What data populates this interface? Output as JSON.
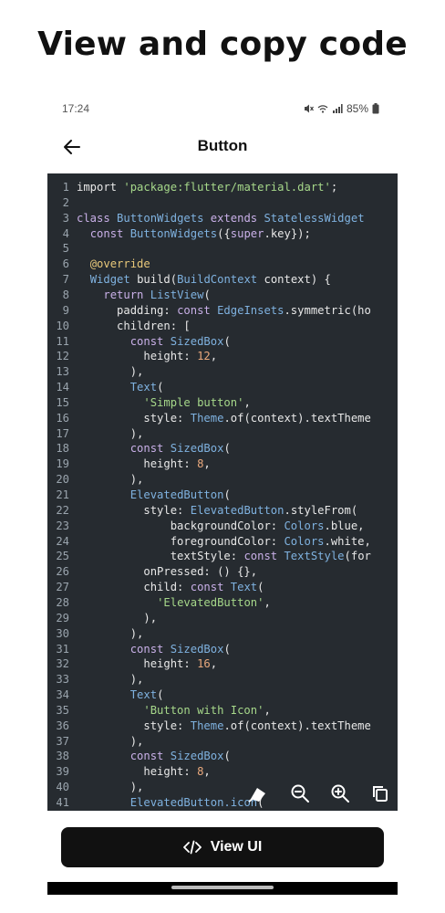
{
  "headline": "View and copy code",
  "status_bar": {
    "time": "17:24",
    "battery": "85%"
  },
  "app_bar": {
    "title": "Button"
  },
  "code_lines": [
    [
      [
        "tx",
        "import "
      ],
      [
        "st",
        "'package:flutter/material.dart'"
      ],
      [
        "tx",
        ";"
      ]
    ],
    [],
    [
      [
        "kw",
        "class "
      ],
      [
        "ty",
        "ButtonWidgets "
      ],
      [
        "kw",
        "extends "
      ],
      [
        "ty",
        "StatelessWidget"
      ]
    ],
    [
      [
        "tx",
        "  "
      ],
      [
        "kw",
        "const "
      ],
      [
        "ty",
        "ButtonWidgets"
      ],
      [
        "tx",
        "({"
      ],
      [
        "kw",
        "super"
      ],
      [
        "tx",
        ".key});"
      ]
    ],
    [],
    [
      [
        "tx",
        "  "
      ],
      [
        "an",
        "@override"
      ]
    ],
    [
      [
        "tx",
        "  "
      ],
      [
        "ty",
        "Widget "
      ],
      [
        "tx",
        "build("
      ],
      [
        "ty",
        "BuildContext "
      ],
      [
        "tx",
        "context) {"
      ]
    ],
    [
      [
        "tx",
        "    "
      ],
      [
        "kw",
        "return "
      ],
      [
        "ty",
        "ListView"
      ],
      [
        "tx",
        "("
      ]
    ],
    [
      [
        "tx",
        "      padding: "
      ],
      [
        "kw",
        "const "
      ],
      [
        "ty",
        "EdgeInsets"
      ],
      [
        "tx",
        ".symmetric(ho"
      ]
    ],
    [
      [
        "tx",
        "      children: ["
      ]
    ],
    [
      [
        "tx",
        "        "
      ],
      [
        "kw",
        "const "
      ],
      [
        "ty",
        "SizedBox"
      ],
      [
        "tx",
        "("
      ]
    ],
    [
      [
        "tx",
        "          height: "
      ],
      [
        "nu",
        "12"
      ],
      [
        "tx",
        ","
      ]
    ],
    [
      [
        "tx",
        "        ),"
      ]
    ],
    [
      [
        "tx",
        "        "
      ],
      [
        "ty",
        "Text"
      ],
      [
        "tx",
        "("
      ]
    ],
    [
      [
        "tx",
        "          "
      ],
      [
        "st",
        "'Simple button'"
      ],
      [
        "tx",
        ","
      ]
    ],
    [
      [
        "tx",
        "          style: "
      ],
      [
        "ty",
        "Theme"
      ],
      [
        "tx",
        ".of(context).textTheme"
      ]
    ],
    [
      [
        "tx",
        "        ),"
      ]
    ],
    [
      [
        "tx",
        "        "
      ],
      [
        "kw",
        "const "
      ],
      [
        "ty",
        "SizedBox"
      ],
      [
        "tx",
        "("
      ]
    ],
    [
      [
        "tx",
        "          height: "
      ],
      [
        "nu",
        "8"
      ],
      [
        "tx",
        ","
      ]
    ],
    [
      [
        "tx",
        "        ),"
      ]
    ],
    [
      [
        "tx",
        "        "
      ],
      [
        "ty",
        "ElevatedButton"
      ],
      [
        "tx",
        "("
      ]
    ],
    [
      [
        "tx",
        "          style: "
      ],
      [
        "ty",
        "ElevatedButton"
      ],
      [
        "tx",
        ".styleFrom("
      ]
    ],
    [
      [
        "tx",
        "              backgroundColor: "
      ],
      [
        "ty",
        "Colors"
      ],
      [
        "tx",
        ".blue,"
      ]
    ],
    [
      [
        "tx",
        "              foregroundColor: "
      ],
      [
        "ty",
        "Colors"
      ],
      [
        "tx",
        ".white,"
      ]
    ],
    [
      [
        "tx",
        "              textStyle: "
      ],
      [
        "kw",
        "const "
      ],
      [
        "ty",
        "TextStyle"
      ],
      [
        "tx",
        "(for"
      ]
    ],
    [
      [
        "tx",
        "          onPressed: () {},"
      ]
    ],
    [
      [
        "tx",
        "          child: "
      ],
      [
        "kw",
        "const "
      ],
      [
        "ty",
        "Text"
      ],
      [
        "tx",
        "("
      ]
    ],
    [
      [
        "tx",
        "            "
      ],
      [
        "st",
        "'ElevatedButton'"
      ],
      [
        "tx",
        ","
      ]
    ],
    [
      [
        "tx",
        "          ),"
      ]
    ],
    [
      [
        "tx",
        "        ),"
      ]
    ],
    [
      [
        "tx",
        "        "
      ],
      [
        "kw",
        "const "
      ],
      [
        "ty",
        "SizedBox"
      ],
      [
        "tx",
        "("
      ]
    ],
    [
      [
        "tx",
        "          height: "
      ],
      [
        "nu",
        "16"
      ],
      [
        "tx",
        ","
      ]
    ],
    [
      [
        "tx",
        "        ),"
      ]
    ],
    [
      [
        "tx",
        "        "
      ],
      [
        "ty",
        "Text"
      ],
      [
        "tx",
        "("
      ]
    ],
    [
      [
        "tx",
        "          "
      ],
      [
        "st",
        "'Button with Icon'"
      ],
      [
        "tx",
        ","
      ]
    ],
    [
      [
        "tx",
        "          style: "
      ],
      [
        "ty",
        "Theme"
      ],
      [
        "tx",
        ".of(context).textTheme"
      ]
    ],
    [
      [
        "tx",
        "        ),"
      ]
    ],
    [
      [
        "tx",
        "        "
      ],
      [
        "kw",
        "const "
      ],
      [
        "ty",
        "SizedBox"
      ],
      [
        "tx",
        "("
      ]
    ],
    [
      [
        "tx",
        "          height: "
      ],
      [
        "nu",
        "8"
      ],
      [
        "tx",
        ","
      ]
    ],
    [
      [
        "tx",
        "        ),"
      ]
    ],
    [
      [
        "tx",
        "        "
      ],
      [
        "ty",
        "ElevatedButton.icon"
      ],
      [
        "tx",
        "("
      ]
    ]
  ],
  "code_toolbar": {
    "icons": [
      "copy-theme-icon",
      "zoom-out-icon",
      "zoom-in-icon",
      "copy-icon"
    ]
  },
  "primary_button": {
    "label": "View UI",
    "icon": "code-icon"
  },
  "colors": {
    "editor_bg": "#262b30",
    "keyword": "#c9b0e8",
    "string": "#a6d88a",
    "type": "#7fb2e0",
    "number": "#e9a87c",
    "annotation": "#e8c87a",
    "button_bg": "#111111"
  }
}
